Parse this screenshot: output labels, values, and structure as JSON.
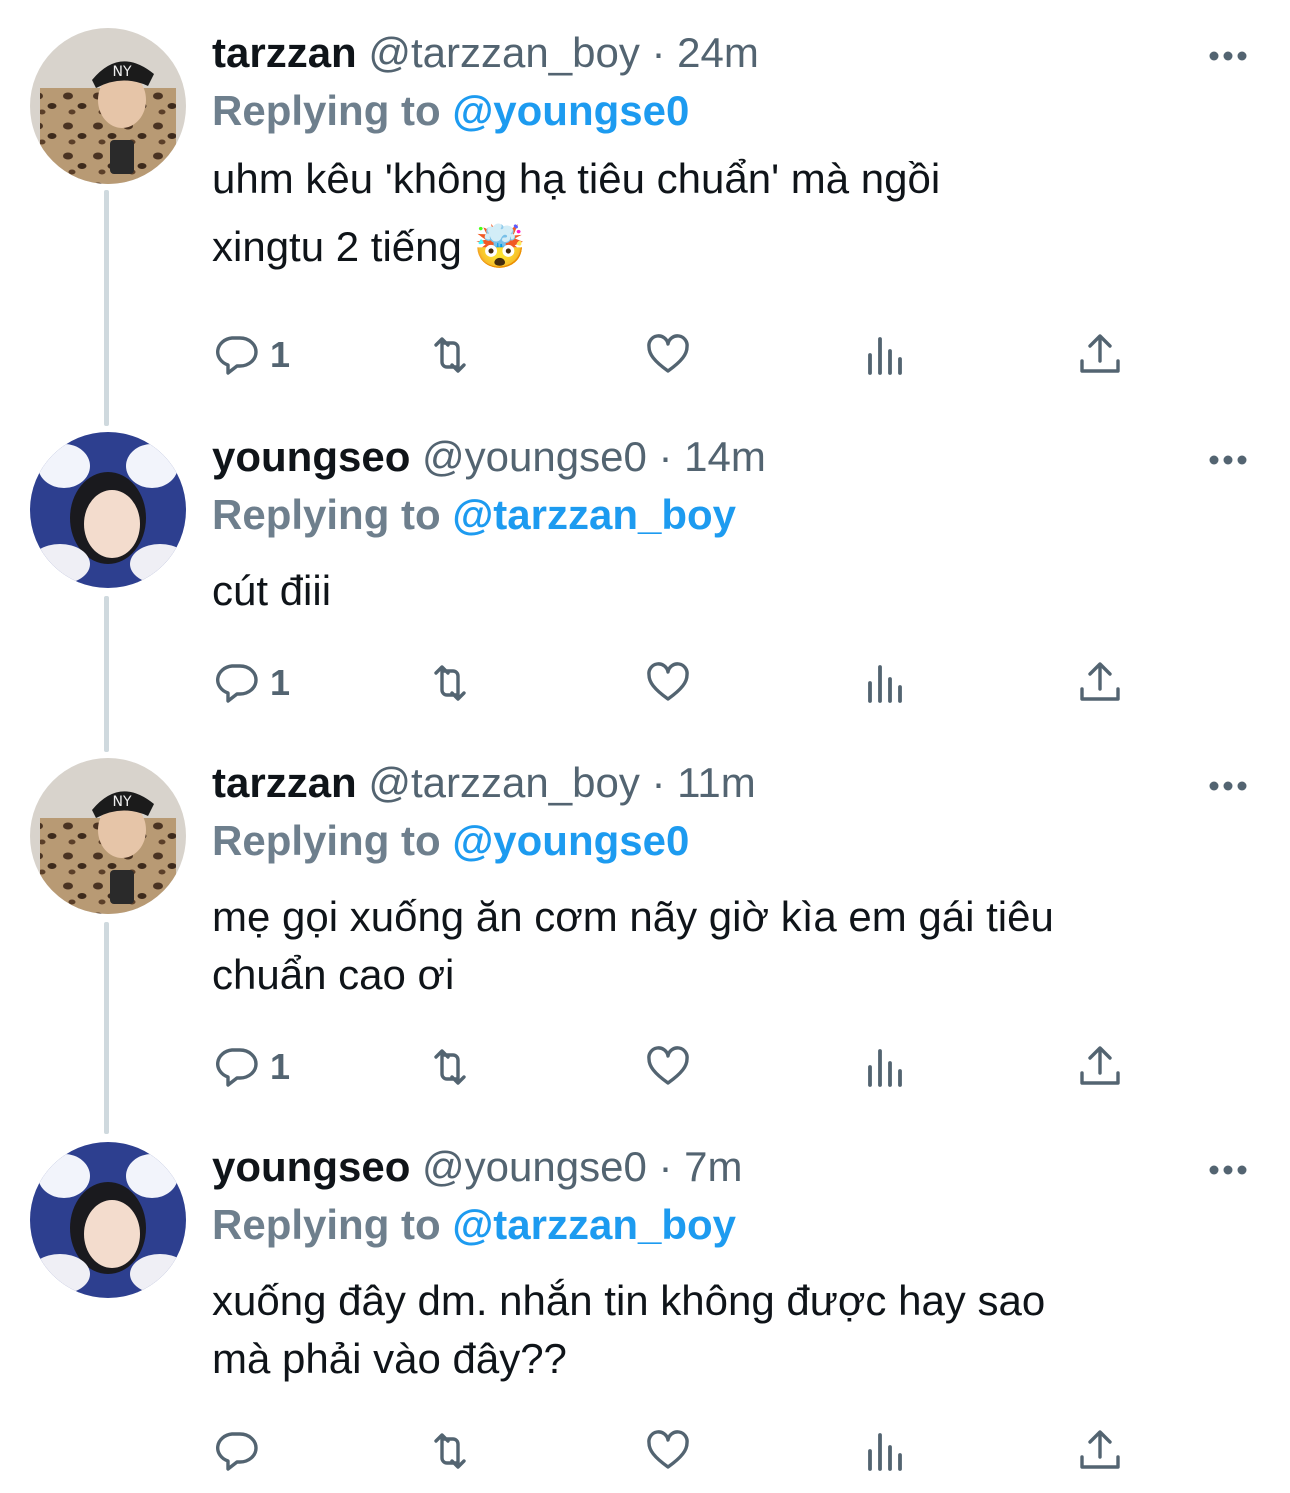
{
  "tweets": [
    {
      "display_name": "tarzzan",
      "handle": "@tarzzan_boy",
      "separator": "·",
      "time": "24m",
      "reply_prefix": "Replying to",
      "reply_to": "@youngse0",
      "text_line1": "uhm kêu 'không hạ tiêu chuẩn' mà ngồi",
      "text_line2": "xingtu 2 tiếng",
      "emoji": "🤯",
      "reply_count": "1",
      "avatar_icon": "cap-person-avatar",
      "accent": "#1d9bf0"
    },
    {
      "display_name": "youngseo",
      "handle": "@youngse0",
      "separator": "·",
      "time": "14m",
      "reply_prefix": "Replying to",
      "reply_to": "@tarzzan_boy",
      "text_line1": "cút điii",
      "text_line2": "",
      "reply_count": "1",
      "avatar_icon": "girl-avatar"
    },
    {
      "display_name": "tarzzan",
      "handle": "@tarzzan_boy",
      "separator": "·",
      "time": "11m",
      "reply_prefix": "Replying to",
      "reply_to": "@youngse0",
      "text_line1": "mẹ gọi xuống ăn cơm nãy giờ kìa em gái tiêu",
      "text_line2": "chuẩn cao ơi",
      "reply_count": "1",
      "avatar_icon": "cap-person-avatar"
    },
    {
      "display_name": "youngseo",
      "handle": "@youngse0",
      "separator": "·",
      "time": "7m",
      "reply_prefix": "Replying to",
      "reply_to": "@tarzzan_boy",
      "text_line1": "xuống đây dm. nhắn tin không được hay sao",
      "text_line2": "mà phải vào đây??",
      "reply_count": "",
      "avatar_icon": "girl-avatar"
    }
  ],
  "icons": {
    "reply": "reply-icon",
    "retweet": "retweet-icon",
    "like": "heart-icon",
    "views": "views-chart-icon",
    "share": "share-icon",
    "more": "more-dots-icon"
  }
}
